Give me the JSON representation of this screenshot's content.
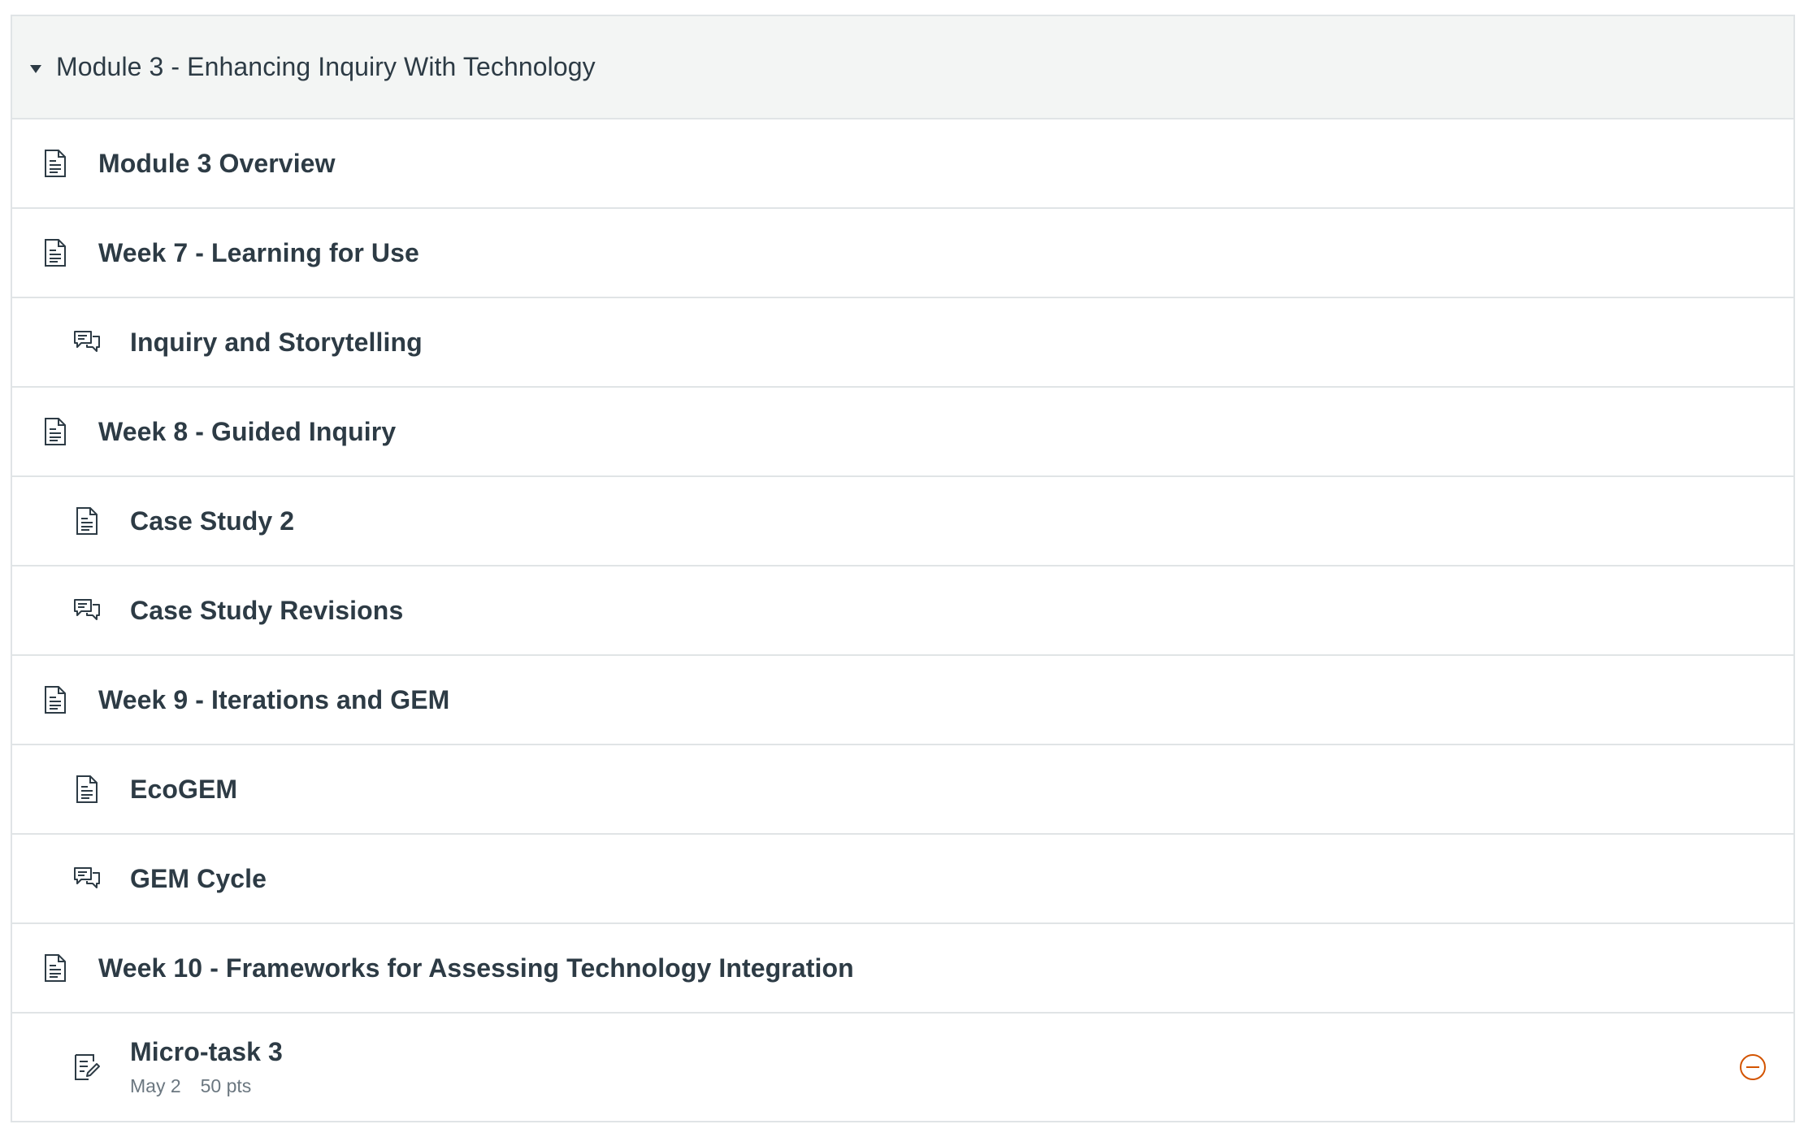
{
  "module": {
    "title": "Module 3 - Enhancing Inquiry With Technology",
    "expanded": true
  },
  "items": [
    {
      "title": "Module 3 Overview",
      "icon": "page-icon",
      "indent": 0
    },
    {
      "title": "Week 7 - Learning for Use",
      "icon": "page-icon",
      "indent": 0
    },
    {
      "title": "Inquiry and Storytelling",
      "icon": "discussion-icon",
      "indent": 1
    },
    {
      "title": "Week 8 - Guided Inquiry",
      "icon": "page-icon",
      "indent": 0
    },
    {
      "title": "Case Study 2",
      "icon": "page-icon",
      "indent": 1
    },
    {
      "title": "Case Study Revisions",
      "icon": "discussion-icon",
      "indent": 1
    },
    {
      "title": "Week 9 - Iterations and GEM",
      "icon": "page-icon",
      "indent": 0
    },
    {
      "title": "EcoGEM",
      "icon": "page-icon",
      "indent": 1
    },
    {
      "title": "GEM Cycle",
      "icon": "discussion-icon",
      "indent": 1
    },
    {
      "title": "Week 10 - Frameworks for Assessing Technology Integration",
      "icon": "page-icon",
      "indent": 0
    },
    {
      "title": "Micro-task 3",
      "icon": "assignment-icon",
      "indent": 1,
      "due": "May 2",
      "points": "50 pts",
      "status_icon": "minus-circle-icon",
      "status_color": "#d35400"
    }
  ],
  "colors": {
    "text": "#2d3b45",
    "muted": "#6b7780",
    "border": "#e0e4e6",
    "header_bg": "#f3f5f4",
    "status": "#d35400"
  }
}
